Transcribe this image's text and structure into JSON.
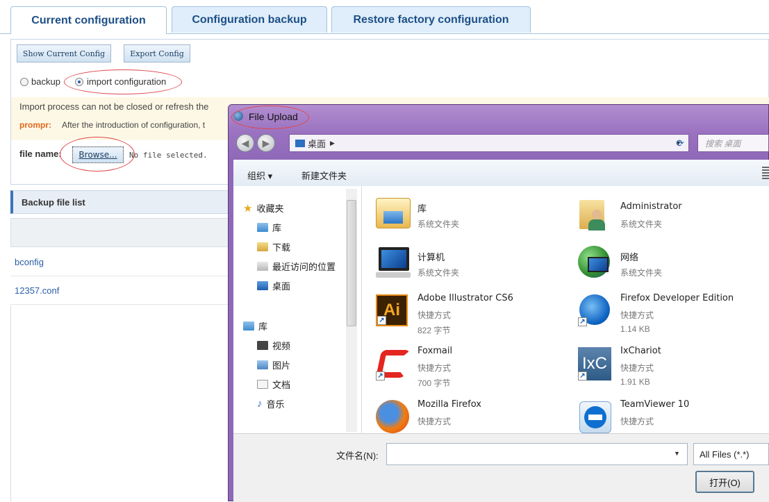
{
  "tabs": [
    {
      "label": "Current configuration"
    },
    {
      "label": "Configuration backup"
    },
    {
      "label": "Restore factory configuration"
    }
  ],
  "config": {
    "show_btn": "Show Current Config",
    "export_btn": "Export Config",
    "radio_backup": "backup",
    "radio_import": "import configuration",
    "warning_line1": "Import process can not be closed or refresh the",
    "prompt_label": "prompr:",
    "warning_line2": "After the introduction of configuration, t",
    "file_name_label": "file name:",
    "browse_btn": "Browse...",
    "no_file": "No file selected."
  },
  "backup_list": {
    "title": "Backup file list",
    "rows": [
      "bconfig",
      "12357.conf"
    ]
  },
  "dialog": {
    "title": "File Upload",
    "address": "桌面",
    "search_placeholder": "搜索 桌面",
    "organize": "组织 ▾",
    "new_folder": "新建文件夹",
    "nav": {
      "favorites": "收藏夹",
      "fav_items": [
        "库",
        "下载",
        "最近访问的位置",
        "桌面"
      ],
      "library": "库",
      "lib_items": [
        "视频",
        "图片",
        "文档",
        "音乐"
      ]
    },
    "items": [
      {
        "title": "库",
        "sub1": "系统文件夹",
        "sub2": ""
      },
      {
        "title": "Administrator",
        "sub1": "系统文件夹",
        "sub2": ""
      },
      {
        "title": "计算机",
        "sub1": "系统文件夹",
        "sub2": ""
      },
      {
        "title": "网络",
        "sub1": "系统文件夹",
        "sub2": ""
      },
      {
        "title": "Adobe Illustrator CS6",
        "sub1": "快捷方式",
        "sub2": "822 字节"
      },
      {
        "title": "Firefox Developer Edition",
        "sub1": "快捷方式",
        "sub2": "1.14 KB"
      },
      {
        "title": "Foxmail",
        "sub1": "快捷方式",
        "sub2": "700 字节"
      },
      {
        "title": "IxChariot",
        "sub1": "快捷方式",
        "sub2": "1.91 KB"
      },
      {
        "title": "Mozilla Firefox",
        "sub1": "快捷方式",
        "sub2": ""
      },
      {
        "title": "TeamViewer 10",
        "sub1": "快捷方式",
        "sub2": ""
      }
    ],
    "filename_label": "文件名(N):",
    "filter": "All Files (*.*)",
    "open_btn": "打开(O)"
  },
  "colors": {
    "accent": "#1d4f86",
    "highlight": "#e0474c",
    "dialog_frame": "#9a72c0"
  },
  "icons": [
    "radio-icon",
    "back-arrow-icon",
    "forward-arrow-icon",
    "folder-icon",
    "star-icon",
    "computer-icon",
    "network-icon",
    "firefox-icon",
    "foxmail-icon",
    "teamviewer-icon",
    "illustrator-icon",
    "ixchariot-icon",
    "user-icon",
    "shortcut-arrow-icon"
  ]
}
